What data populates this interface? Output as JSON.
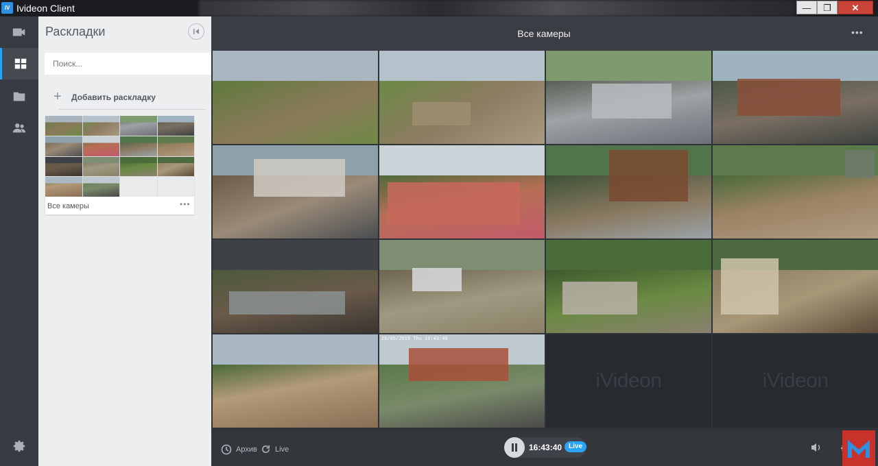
{
  "window": {
    "app_icon": "ivideon-app-icon",
    "title": "Ivideon Client",
    "minimize": "—",
    "maximize": "❐",
    "close": "✕"
  },
  "nav": {
    "items": [
      {
        "icon": "camera-icon",
        "active": false
      },
      {
        "icon": "layouts-grid-icon",
        "active": true
      },
      {
        "icon": "folder-icon",
        "active": false
      },
      {
        "icon": "users-icon",
        "active": false
      }
    ],
    "settings_icon": "gear-icon"
  },
  "panel": {
    "title": "Раскладки",
    "search_placeholder": "Поиск...",
    "add_layout": "Добавить раскладку",
    "layouts": [
      {
        "name": "Все камеры",
        "more": "•••"
      }
    ]
  },
  "main": {
    "title": "Все камеры",
    "more": "•••",
    "cameras": [
      {
        "id": 1,
        "scene": "field",
        "selected": true
      },
      {
        "id": 2,
        "scene": "field-wood"
      },
      {
        "id": 3,
        "scene": "slab"
      },
      {
        "id": 4,
        "scene": "walls"
      },
      {
        "id": 5,
        "scene": "roof"
      },
      {
        "id": 6,
        "scene": "bricks"
      },
      {
        "id": 7,
        "scene": "scaffold"
      },
      {
        "id": 8,
        "scene": "dirt"
      },
      {
        "id": 9,
        "scene": "storm"
      },
      {
        "id": 10,
        "scene": "foundation"
      },
      {
        "id": 11,
        "scene": "trees"
      },
      {
        "id": 12,
        "scene": "trench"
      },
      {
        "id": 13,
        "scene": "pit"
      },
      {
        "id": 14,
        "scene": "brick-house",
        "timestamp": "26/05/2019 Thu 16:43:40"
      }
    ],
    "empty_slots": [
      {
        "logo": "iVideon"
      },
      {
        "logo": "iVideon"
      }
    ]
  },
  "controls": {
    "archive_label": "Архив",
    "live_label": "Live",
    "time": "16:43:40",
    "live_badge": "Live",
    "icons": {
      "archive": "clock-icon",
      "live": "refresh-icon",
      "pause": "pause-icon",
      "volume": "speaker-icon",
      "settings": "gear-icon"
    }
  },
  "colors": {
    "accent": "#29a3f5",
    "nav_bg": "#383c42",
    "panel_bg": "#eceef0",
    "main_bg": "#2f3237"
  }
}
